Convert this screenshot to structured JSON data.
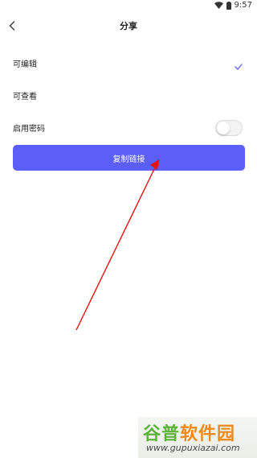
{
  "status_bar": {
    "time": "9:57",
    "icons": [
      "wifi-icon",
      "battery-icon"
    ]
  },
  "nav": {
    "back_icon": "chevron-left-icon",
    "title": "分享"
  },
  "options": [
    {
      "label": "可编辑",
      "selected": true
    },
    {
      "label": "可查看",
      "selected": false
    }
  ],
  "password": {
    "label": "启用密码",
    "enabled": false
  },
  "copy_button": {
    "label": "复制链接"
  },
  "watermark": {
    "part1": "谷普",
    "part2": "软件园",
    "url": "www.gupuxiazai.com"
  },
  "colors": {
    "accent": "#5b5ef7",
    "check": "#5b5ef7",
    "arrow": "#e8120c",
    "watermark_green": "#5cb33a",
    "watermark_orange": "#f08a1c"
  }
}
